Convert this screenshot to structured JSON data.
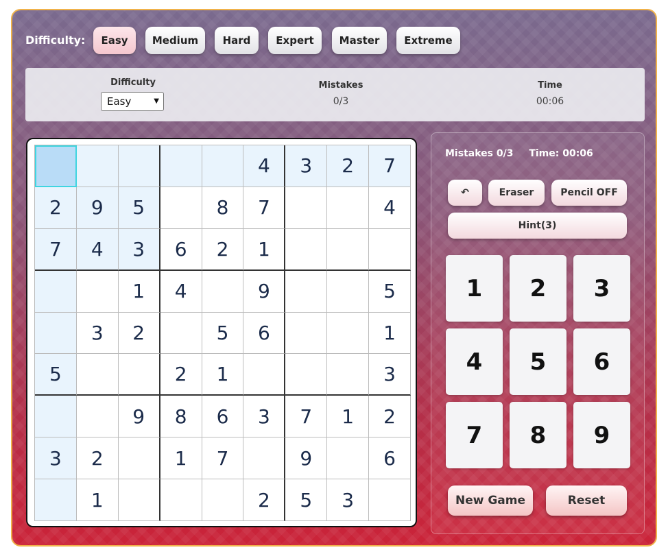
{
  "header": {
    "difficulty_label": "Difficulty:",
    "levels": [
      "Easy",
      "Medium",
      "Hard",
      "Expert",
      "Master",
      "Extreme"
    ],
    "active_level": "Easy"
  },
  "info": {
    "difficulty_title": "Difficulty",
    "difficulty_value": "Easy",
    "mistakes_title": "Mistakes",
    "mistakes_value": "0/3",
    "time_title": "Time",
    "time_value": "00:06"
  },
  "board": {
    "rows": [
      [
        "",
        "",
        "",
        "",
        "",
        "4",
        "3",
        "2",
        "7"
      ],
      [
        "2",
        "9",
        "5",
        "",
        "8",
        "7",
        "",
        "",
        "4"
      ],
      [
        "7",
        "4",
        "3",
        "6",
        "2",
        "1",
        "",
        "",
        ""
      ],
      [
        "",
        "",
        "1",
        "4",
        "",
        "9",
        "",
        "",
        "5"
      ],
      [
        "",
        "3",
        "2",
        "",
        "5",
        "6",
        "",
        "",
        "1"
      ],
      [
        "5",
        "",
        "",
        "2",
        "1",
        "",
        "",
        "",
        "3"
      ],
      [
        "",
        "",
        "9",
        "8",
        "6",
        "3",
        "7",
        "1",
        "2"
      ],
      [
        "3",
        "2",
        "",
        "1",
        "7",
        "",
        "9",
        "",
        "6"
      ],
      [
        "",
        "1",
        "",
        "",
        "",
        "2",
        "5",
        "3",
        ""
      ]
    ],
    "selected": [
      0,
      0
    ]
  },
  "side": {
    "mistakes_text": "Mistakes 0/3",
    "time_text": "Time: 00:06",
    "undo_label": "↶",
    "eraser_label": "Eraser",
    "pencil_label": "Pencil OFF",
    "hint_label": "Hint(3)",
    "numbers": [
      "1",
      "2",
      "3",
      "4",
      "5",
      "6",
      "7",
      "8",
      "9"
    ],
    "new_game_label": "New Game",
    "reset_label": "Reset"
  }
}
